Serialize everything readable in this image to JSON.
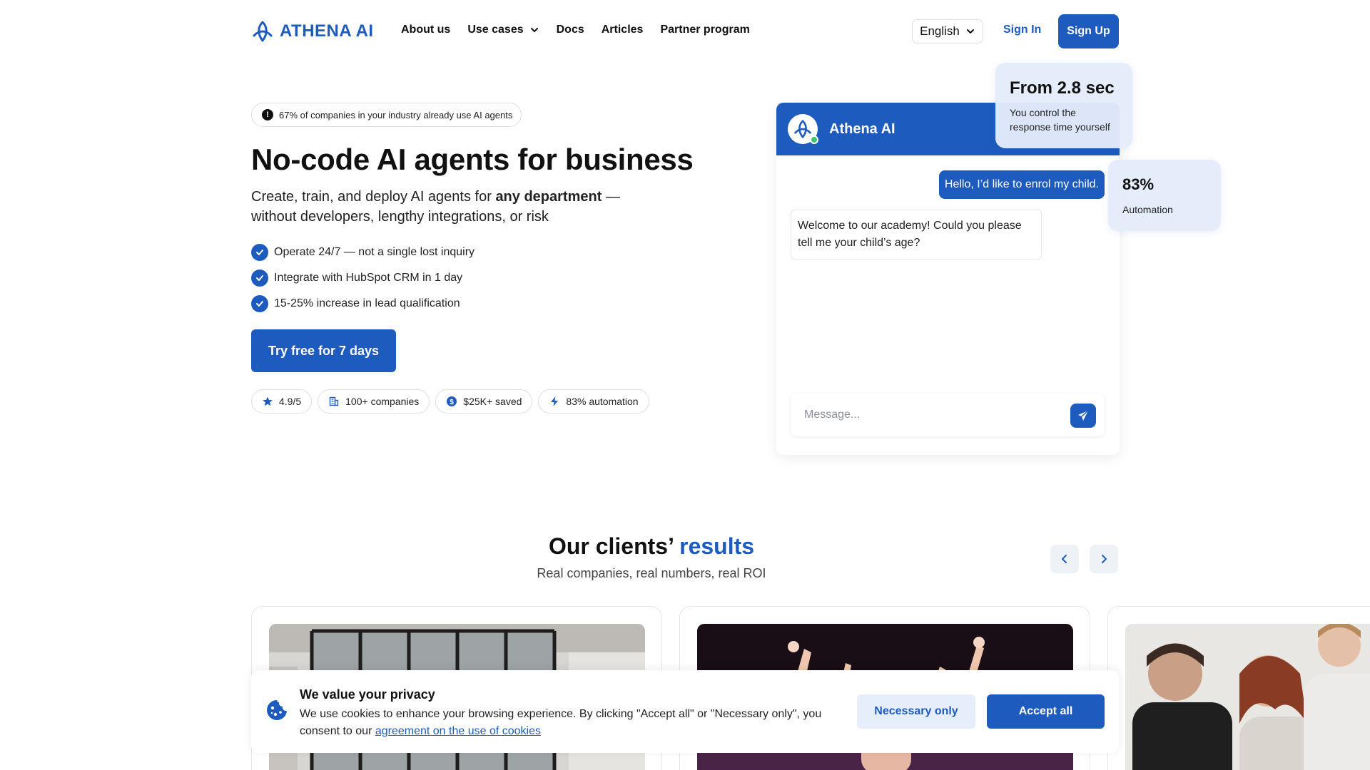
{
  "header": {
    "logo_text": "ATHENA AI",
    "nav": [
      {
        "label": "About us"
      },
      {
        "label": "Use cases"
      },
      {
        "label": "Docs"
      },
      {
        "label": "Articles"
      },
      {
        "label": "Partner program"
      }
    ],
    "language": "English",
    "sign_in": "Sign In",
    "sign_up": "Sign Up"
  },
  "hero": {
    "badge_text": "67% of companies in your industry already use AI agents",
    "title": "No-code AI agents for business",
    "subtitle_pre": "Create, train, and deploy AI agents for ",
    "subtitle_bold": "any department",
    "subtitle_post": " — without developers, lengthy integrations, or risk",
    "checks": [
      "Operate 24/7 — not a single lost inquiry",
      "Integrate with HubSpot CRM in 1 day",
      "15-25% increase in lead qualification"
    ],
    "cta": "Try free for 7 days",
    "stats": [
      {
        "icon": "star-icon",
        "label": "4.9/5"
      },
      {
        "icon": "building-icon",
        "label": "100+ companies"
      },
      {
        "icon": "dollar-icon",
        "label": "$25K+ saved"
      },
      {
        "icon": "lightning-icon",
        "label": "83% automation"
      }
    ]
  },
  "chat": {
    "name": "Athena AI",
    "user_message": "Hello, I’d like to enrol my child.",
    "bot_message": "Welcome to our academy! Could you please tell me your child’s age?",
    "input_placeholder": "Message..."
  },
  "floats": {
    "response": {
      "value": "From 2.8 sec",
      "text": "You control the response time yourself"
    },
    "automation": {
      "value": "83%",
      "text": "Automation"
    }
  },
  "results": {
    "title_pre": "Our clients’ ",
    "title_accent": "results",
    "subtitle": "Real companies, real numbers, real ROI"
  },
  "cookie": {
    "title": "We value your privacy",
    "text": "We use cookies to enhance your browsing experience. By clicking \"Accept all\" or \"Necessary only\", you consent to our ",
    "link": "agreement on the use of cookies",
    "necessary": "Necessary only",
    "accept": "Accept all"
  },
  "colors": {
    "brand": "#1d5bbf",
    "float_bg": "#e4ecfa"
  }
}
